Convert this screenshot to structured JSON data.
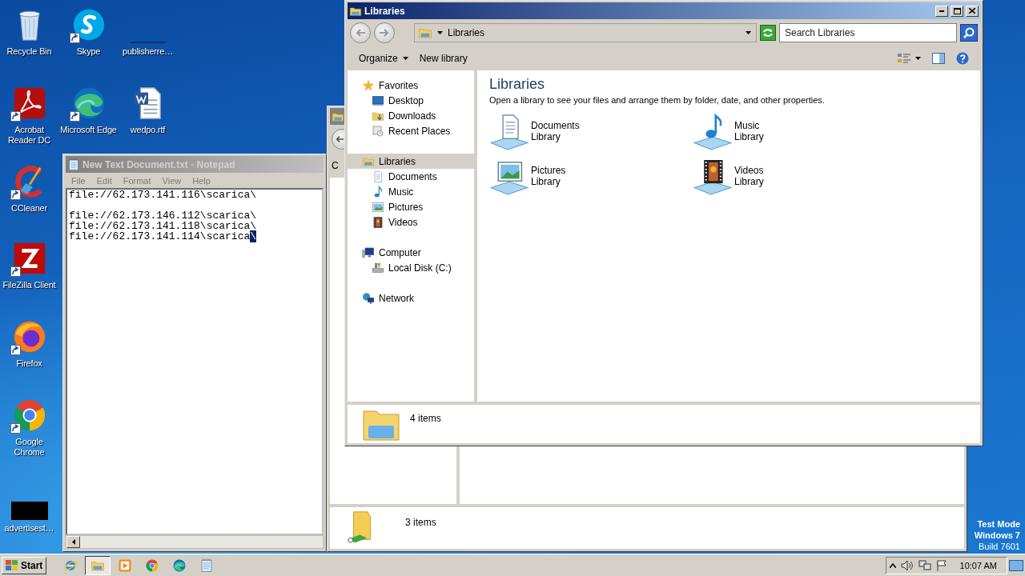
{
  "desktop": {
    "icons": [
      {
        "label": "Recycle Bin",
        "kind": "recycle",
        "shortcut": false
      },
      {
        "label": "Skype",
        "kind": "skype",
        "shortcut": true
      },
      {
        "label": "publisherre…",
        "kind": "blank",
        "shortcut": false
      },
      {
        "label": "Acrobat Reader DC",
        "kind": "acrobat",
        "shortcut": true
      },
      {
        "label": "Microsoft Edge",
        "kind": "edge",
        "shortcut": true
      },
      {
        "label": "wedpo.rtf",
        "kind": "word",
        "shortcut": false
      },
      {
        "label": "CCleaner",
        "kind": "ccleaner",
        "shortcut": true
      },
      {
        "label": "FileZilla Client",
        "kind": "filezilla",
        "shortcut": true
      },
      {
        "label": "Firefox",
        "kind": "firefox",
        "shortcut": true
      },
      {
        "label": "Google Chrome",
        "kind": "chrome",
        "shortcut": true
      },
      {
        "label": "advertisest…",
        "kind": "black",
        "shortcut": false
      }
    ]
  },
  "notepad": {
    "title": "New Text Document.txt - Notepad",
    "active": false,
    "menu": [
      "File",
      "Edit",
      "Format",
      "View",
      "Help"
    ],
    "text": "file://62.173.141.116\\scarica\\\n\nfile://62.173.146.112\\scarica\\\nfile://62.173.141.118\\scarica\\\nfile://62.173.141.114\\scarica",
    "selection": "\\"
  },
  "background_window": {
    "column_1": "C",
    "status": "3 items"
  },
  "explorer": {
    "title": "Libraries",
    "active": true,
    "address": "Libraries",
    "search": {
      "placeholder": "Search Libraries"
    },
    "toolbar": [
      {
        "label": "Organize",
        "dropdown": true
      },
      {
        "label": "New library",
        "dropdown": false
      }
    ],
    "nav": [
      {
        "label": "Favorites",
        "kind": "star",
        "selected": false,
        "children": [
          {
            "label": "Desktop",
            "kind": "desktop",
            "selected": false
          },
          {
            "label": "Downloads",
            "kind": "downloads",
            "selected": false
          },
          {
            "label": "Recent Places",
            "kind": "recent",
            "selected": false
          }
        ]
      },
      {
        "label": "Libraries",
        "kind": "library",
        "selected": true,
        "children": [
          {
            "label": "Documents",
            "kind": "documents",
            "selected": false
          },
          {
            "label": "Music",
            "kind": "music",
            "selected": false
          },
          {
            "label": "Pictures",
            "kind": "pictures",
            "selected": false
          },
          {
            "label": "Videos",
            "kind": "videos",
            "selected": false
          }
        ]
      },
      {
        "label": "Computer",
        "kind": "computer",
        "selected": false,
        "children": [
          {
            "label": "Local Disk (C:)",
            "kind": "disk",
            "selected": false
          }
        ]
      },
      {
        "label": "Network",
        "kind": "network",
        "selected": false
      }
    ],
    "heading": "Libraries",
    "description": "Open a library to see your files and arrange them by folder, date, and other properties.",
    "libraries": [
      {
        "name": "Documents",
        "type": "Library",
        "kind": "documents"
      },
      {
        "name": "Music",
        "type": "Library",
        "kind": "music"
      },
      {
        "name": "Pictures",
        "type": "Library",
        "kind": "pictures"
      },
      {
        "name": "Videos",
        "type": "Library",
        "kind": "videos"
      }
    ],
    "status": "4 items"
  },
  "taskbar": {
    "start": "Start",
    "apps": [
      {
        "kind": "ie",
        "active": false
      },
      {
        "kind": "explorer",
        "active": true
      },
      {
        "kind": "media",
        "active": false
      },
      {
        "kind": "chrome",
        "active": false
      },
      {
        "kind": "edge",
        "active": false
      },
      {
        "kind": "notepad",
        "active": false
      }
    ],
    "clock": "10:07 AM"
  },
  "test_mode": [
    "Test Mode",
    "Windows 7",
    "Build 7601"
  ]
}
